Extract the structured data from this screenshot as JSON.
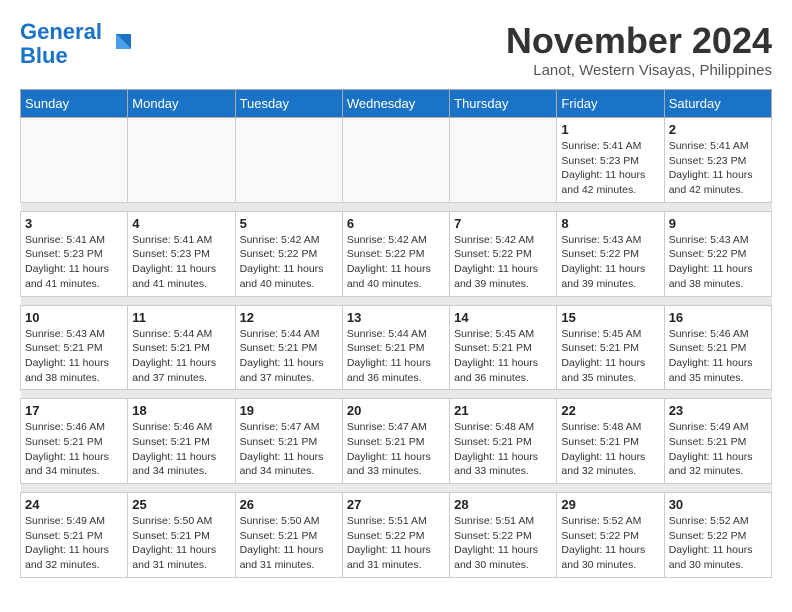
{
  "header": {
    "logo_line1": "General",
    "logo_line2": "Blue",
    "month_title": "November 2024",
    "location": "Lanot, Western Visayas, Philippines"
  },
  "weekdays": [
    "Sunday",
    "Monday",
    "Tuesday",
    "Wednesday",
    "Thursday",
    "Friday",
    "Saturday"
  ],
  "weeks": [
    [
      {
        "day": "",
        "info": ""
      },
      {
        "day": "",
        "info": ""
      },
      {
        "day": "",
        "info": ""
      },
      {
        "day": "",
        "info": ""
      },
      {
        "day": "",
        "info": ""
      },
      {
        "day": "1",
        "info": "Sunrise: 5:41 AM\nSunset: 5:23 PM\nDaylight: 11 hours and 42 minutes."
      },
      {
        "day": "2",
        "info": "Sunrise: 5:41 AM\nSunset: 5:23 PM\nDaylight: 11 hours and 42 minutes."
      }
    ],
    [
      {
        "day": "3",
        "info": "Sunrise: 5:41 AM\nSunset: 5:23 PM\nDaylight: 11 hours and 41 minutes."
      },
      {
        "day": "4",
        "info": "Sunrise: 5:41 AM\nSunset: 5:23 PM\nDaylight: 11 hours and 41 minutes."
      },
      {
        "day": "5",
        "info": "Sunrise: 5:42 AM\nSunset: 5:22 PM\nDaylight: 11 hours and 40 minutes."
      },
      {
        "day": "6",
        "info": "Sunrise: 5:42 AM\nSunset: 5:22 PM\nDaylight: 11 hours and 40 minutes."
      },
      {
        "day": "7",
        "info": "Sunrise: 5:42 AM\nSunset: 5:22 PM\nDaylight: 11 hours and 39 minutes."
      },
      {
        "day": "8",
        "info": "Sunrise: 5:43 AM\nSunset: 5:22 PM\nDaylight: 11 hours and 39 minutes."
      },
      {
        "day": "9",
        "info": "Sunrise: 5:43 AM\nSunset: 5:22 PM\nDaylight: 11 hours and 38 minutes."
      }
    ],
    [
      {
        "day": "10",
        "info": "Sunrise: 5:43 AM\nSunset: 5:21 PM\nDaylight: 11 hours and 38 minutes."
      },
      {
        "day": "11",
        "info": "Sunrise: 5:44 AM\nSunset: 5:21 PM\nDaylight: 11 hours and 37 minutes."
      },
      {
        "day": "12",
        "info": "Sunrise: 5:44 AM\nSunset: 5:21 PM\nDaylight: 11 hours and 37 minutes."
      },
      {
        "day": "13",
        "info": "Sunrise: 5:44 AM\nSunset: 5:21 PM\nDaylight: 11 hours and 36 minutes."
      },
      {
        "day": "14",
        "info": "Sunrise: 5:45 AM\nSunset: 5:21 PM\nDaylight: 11 hours and 36 minutes."
      },
      {
        "day": "15",
        "info": "Sunrise: 5:45 AM\nSunset: 5:21 PM\nDaylight: 11 hours and 35 minutes."
      },
      {
        "day": "16",
        "info": "Sunrise: 5:46 AM\nSunset: 5:21 PM\nDaylight: 11 hours and 35 minutes."
      }
    ],
    [
      {
        "day": "17",
        "info": "Sunrise: 5:46 AM\nSunset: 5:21 PM\nDaylight: 11 hours and 34 minutes."
      },
      {
        "day": "18",
        "info": "Sunrise: 5:46 AM\nSunset: 5:21 PM\nDaylight: 11 hours and 34 minutes."
      },
      {
        "day": "19",
        "info": "Sunrise: 5:47 AM\nSunset: 5:21 PM\nDaylight: 11 hours and 34 minutes."
      },
      {
        "day": "20",
        "info": "Sunrise: 5:47 AM\nSunset: 5:21 PM\nDaylight: 11 hours and 33 minutes."
      },
      {
        "day": "21",
        "info": "Sunrise: 5:48 AM\nSunset: 5:21 PM\nDaylight: 11 hours and 33 minutes."
      },
      {
        "day": "22",
        "info": "Sunrise: 5:48 AM\nSunset: 5:21 PM\nDaylight: 11 hours and 32 minutes."
      },
      {
        "day": "23",
        "info": "Sunrise: 5:49 AM\nSunset: 5:21 PM\nDaylight: 11 hours and 32 minutes."
      }
    ],
    [
      {
        "day": "24",
        "info": "Sunrise: 5:49 AM\nSunset: 5:21 PM\nDaylight: 11 hours and 32 minutes."
      },
      {
        "day": "25",
        "info": "Sunrise: 5:50 AM\nSunset: 5:21 PM\nDaylight: 11 hours and 31 minutes."
      },
      {
        "day": "26",
        "info": "Sunrise: 5:50 AM\nSunset: 5:21 PM\nDaylight: 11 hours and 31 minutes."
      },
      {
        "day": "27",
        "info": "Sunrise: 5:51 AM\nSunset: 5:22 PM\nDaylight: 11 hours and 31 minutes."
      },
      {
        "day": "28",
        "info": "Sunrise: 5:51 AM\nSunset: 5:22 PM\nDaylight: 11 hours and 30 minutes."
      },
      {
        "day": "29",
        "info": "Sunrise: 5:52 AM\nSunset: 5:22 PM\nDaylight: 11 hours and 30 minutes."
      },
      {
        "day": "30",
        "info": "Sunrise: 5:52 AM\nSunset: 5:22 PM\nDaylight: 11 hours and 30 minutes."
      }
    ]
  ]
}
